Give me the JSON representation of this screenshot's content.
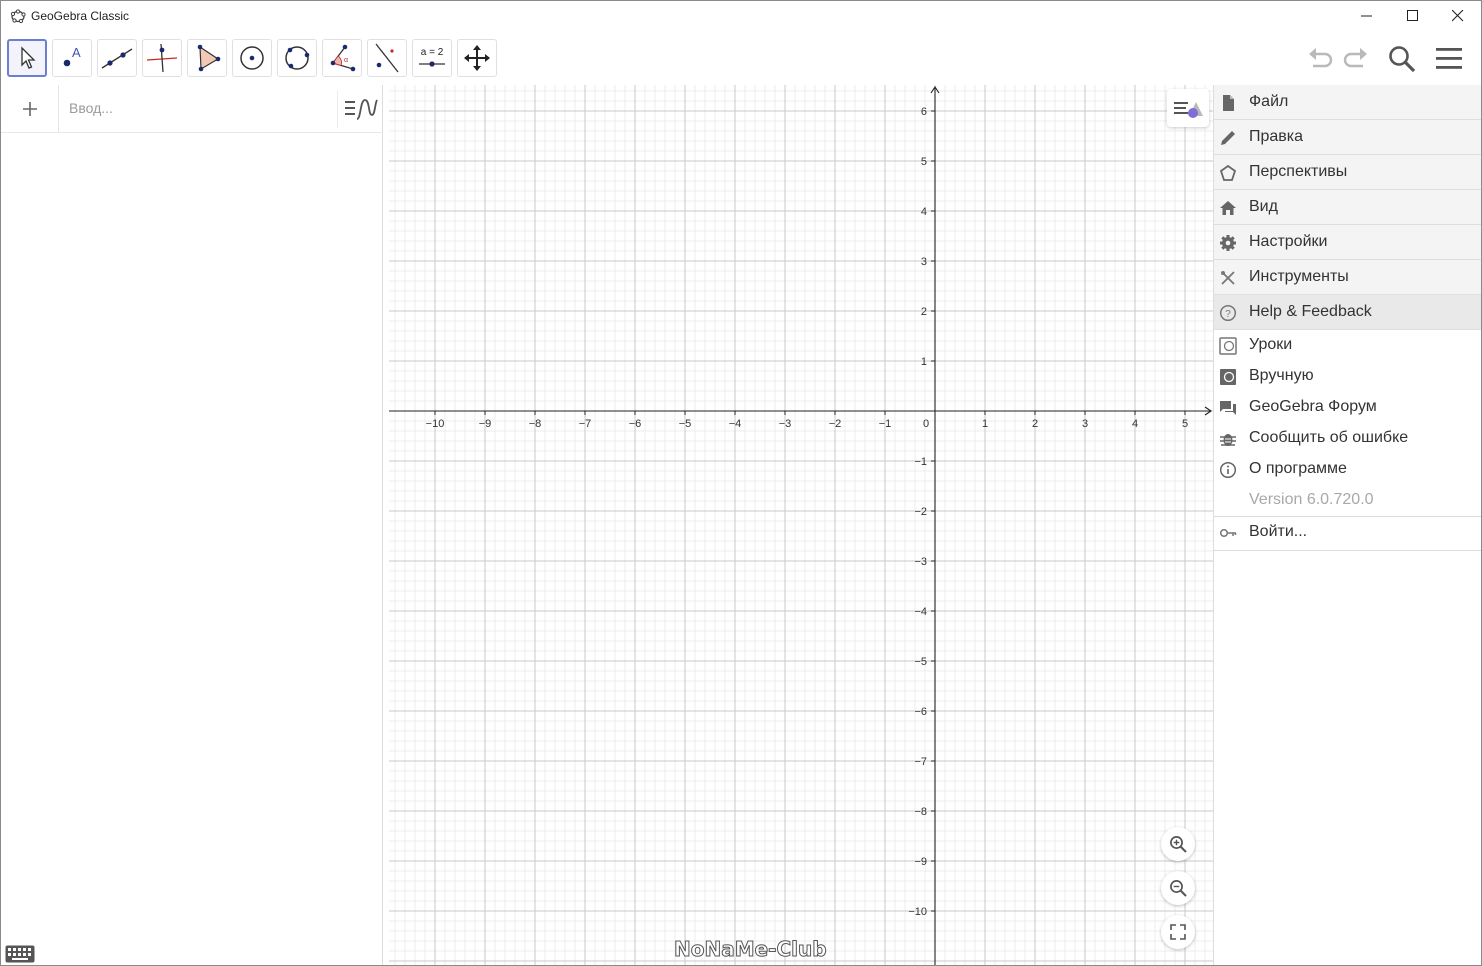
{
  "window": {
    "title": "GeoGebra Classic",
    "controls": [
      "minimize",
      "maximize",
      "close"
    ]
  },
  "toolbar": {
    "tools": [
      {
        "name": "move-tool",
        "icon": "arrow-cursor-icon",
        "selected": true
      },
      {
        "name": "point-tool",
        "icon": "point-icon",
        "label": "A"
      },
      {
        "name": "line-tool",
        "icon": "line-through-two-points-icon"
      },
      {
        "name": "perpendicular-line-tool",
        "icon": "perpendicular-line-icon"
      },
      {
        "name": "polygon-tool",
        "icon": "polygon-icon"
      },
      {
        "name": "circle-tool",
        "icon": "circle-center-point-icon"
      },
      {
        "name": "circle-three-points-tool",
        "icon": "circle-three-points-icon"
      },
      {
        "name": "angle-tool",
        "icon": "angle-icon"
      },
      {
        "name": "reflect-tool",
        "icon": "reflect-about-line-icon"
      },
      {
        "name": "slider-tool",
        "icon": "slider-icon",
        "label": "a = 2"
      },
      {
        "name": "move-graphics-tool",
        "icon": "move-graphics-icon"
      }
    ],
    "right": [
      "undo-icon",
      "redo-icon",
      "search-icon",
      "hamburger-menu-icon"
    ]
  },
  "algebra": {
    "input_placeholder": "Ввод..."
  },
  "graphics": {
    "x_ticks": [
      "−10",
      "−9",
      "−8",
      "−7",
      "−6",
      "−5",
      "−4",
      "−3",
      "−2",
      "−1",
      "0",
      "1",
      "2",
      "3",
      "4",
      "5"
    ],
    "y_ticks_pos": [
      "6",
      "5",
      "4",
      "3",
      "2",
      "1"
    ],
    "y_ticks_neg": [
      "−1",
      "−2",
      "−3",
      "−4",
      "−5",
      "−6",
      "−7",
      "−8",
      "−9",
      "−10"
    ],
    "x_range": [
      -11,
      5.5
    ],
    "y_range": [
      -11,
      6.5
    ],
    "grid": true,
    "zoom_buttons": [
      "zoom-in-icon",
      "zoom-out-icon",
      "fullscreen-icon"
    ],
    "watermark": "NoNaMe-Club"
  },
  "menu": {
    "main_items": [
      {
        "label": "Файл",
        "icon": "file-icon"
      },
      {
        "label": "Правка",
        "icon": "pencil-icon"
      },
      {
        "label": "Перспективы",
        "icon": "pentagon-icon"
      },
      {
        "label": "Вид",
        "icon": "home-icon"
      },
      {
        "label": "Настройки",
        "icon": "gear-icon"
      },
      {
        "label": "Инструменты",
        "icon": "tools-icon"
      },
      {
        "label": "Help & Feedback",
        "icon": "help-icon"
      }
    ],
    "help_items": [
      {
        "label": "Уроки",
        "icon": "tutorial-icon"
      },
      {
        "label": "Вручную",
        "icon": "manual-icon"
      },
      {
        "label": "GeoGebra Форум",
        "icon": "forum-icon"
      },
      {
        "label": "Сообщить об ошибке",
        "icon": "bug-icon"
      },
      {
        "label": "О программе",
        "icon": "info-icon"
      }
    ],
    "version": "Version 6.0.720.0",
    "sign_in": {
      "label": "Войти...",
      "icon": "sign-in-icon"
    }
  },
  "colors": {
    "accent": "#6a7fd1",
    "grid_major": "#c8c8c8",
    "grid_minor": "#ececec",
    "axis": "#222222",
    "point": "#1565c0"
  }
}
